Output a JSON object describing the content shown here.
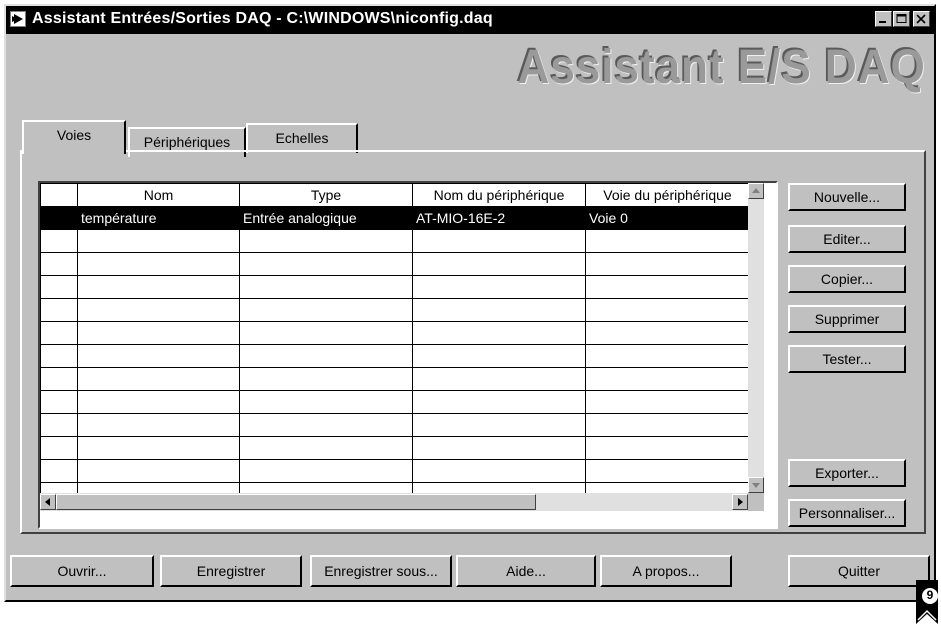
{
  "window": {
    "title": "Assistant Entrées/Sorties DAQ - C:\\WINDOWS\\niconfig.daq",
    "banner": "Assistant E/S DAQ"
  },
  "tabs": [
    {
      "label": "Voies",
      "active": true
    },
    {
      "label": "Périphériques",
      "active": false
    },
    {
      "label": "Echelles",
      "active": false
    }
  ],
  "table": {
    "columns": [
      "Nom",
      "Type",
      "Nom du périphérique",
      "Voie du périphérique"
    ],
    "rows": [
      [
        "température",
        "Entrée analogique",
        "AT-MIO-16E-2",
        "Voie 0"
      ]
    ],
    "selected_row": 0
  },
  "side_buttons": {
    "new": "Nouvelle...",
    "edit": "Editer...",
    "copy": "Copier...",
    "delete": "Supprimer",
    "test": "Tester...",
    "export": "Exporter...",
    "customize": "Personnaliser..."
  },
  "bottom_buttons": {
    "open": "Ouvrir...",
    "save": "Enregistrer",
    "save_as": "Enregistrer sous...",
    "help": "Aide...",
    "about": "A propos...",
    "quit": "Quitter"
  },
  "page_number": "9",
  "icons": {
    "app": "run-arrow-icon",
    "minimize": "minimize-icon",
    "maximize": "maximize-icon",
    "close": "close-icon"
  },
  "colors": {
    "face": "#c0c0c0",
    "titlebar": "#000000",
    "selection": "#000000"
  }
}
